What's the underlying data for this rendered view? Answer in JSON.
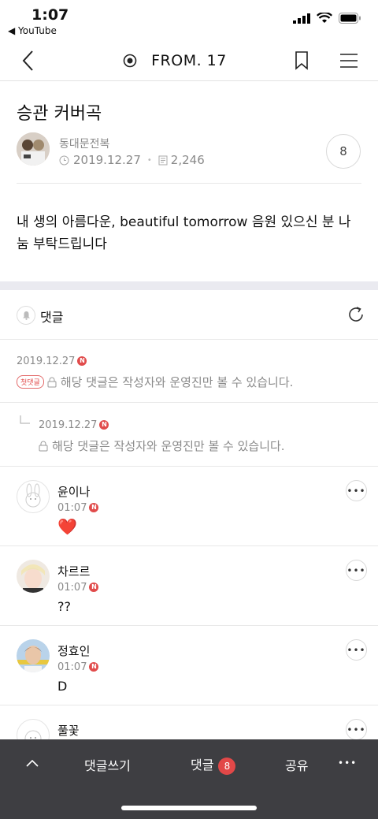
{
  "status_bar": {
    "time": "1:07",
    "back_app": "◀ YouTube"
  },
  "nav": {
    "title": "FROM. 17"
  },
  "post": {
    "title": "승관 커버곡",
    "author": "동대문전복",
    "date": "2019.12.27",
    "views": "2,246",
    "comment_count": "8",
    "body": "내 생의 아름다운, beautiful tomorrow 음원 있으신 분 나눔 부탁드립니다"
  },
  "comments_section": {
    "label": "댓글"
  },
  "locked_comments": [
    {
      "date": "2019.12.27",
      "tag": "첫댓글",
      "text": "해당 댓글은 작성자와 운영진만 볼 수 있습니다."
    },
    {
      "date": "2019.12.27",
      "text": "해당 댓글은 작성자와 운영진만 볼 수 있습니다."
    }
  ],
  "comments": [
    {
      "nickname": "윤이나",
      "time": "01:07",
      "text": "❤️"
    },
    {
      "nickname": "차르르",
      "time": "01:07",
      "text": "??"
    },
    {
      "nickname": "정효인",
      "time": "01:07",
      "text": "D"
    },
    {
      "nickname": "풀꽃",
      "time": "",
      "text": ""
    }
  ],
  "new_badge": "N",
  "bottom_bar": {
    "write_comment": "댓글쓰기",
    "comments": "댓글",
    "comments_count": "8",
    "share": "공유",
    "more": "•••"
  },
  "colors": {
    "accent_red": "#e14b4b",
    "bottom_bar_bg": "#3e3e42",
    "divider_band": "#eaeaf0"
  }
}
